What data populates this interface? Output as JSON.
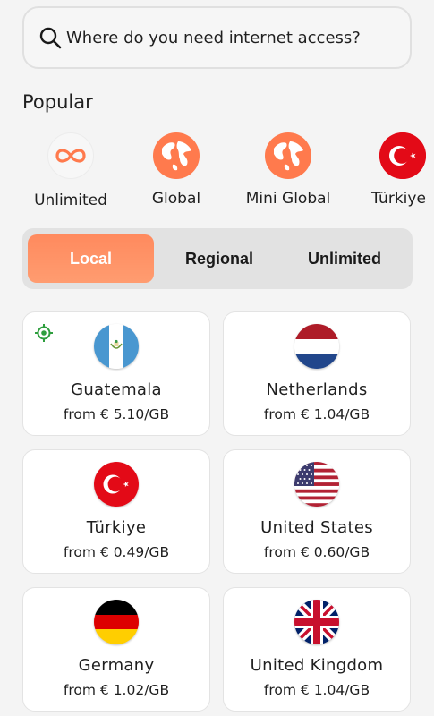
{
  "search": {
    "placeholder": "Where do you need internet access?"
  },
  "popular": {
    "title": "Popular",
    "items": [
      {
        "label": "Unlimited",
        "icon": "infinity-icon"
      },
      {
        "label": "Global",
        "icon": "globe-icon"
      },
      {
        "label": "Mini Global",
        "icon": "globe-icon"
      },
      {
        "label": "Türkiye",
        "icon": "turkey-flag-icon"
      }
    ]
  },
  "tabs": [
    {
      "label": "Local",
      "active": true
    },
    {
      "label": "Regional",
      "active": false
    },
    {
      "label": "Unlimited",
      "active": false
    }
  ],
  "countries": [
    {
      "name": "Guatemala",
      "price": "from € 5.10/GB",
      "flag": "guatemala-flag-icon",
      "current_location": true
    },
    {
      "name": "Netherlands",
      "price": "from € 1.04/GB",
      "flag": "netherlands-flag-icon"
    },
    {
      "name": "Türkiye",
      "price": "from € 0.49/GB",
      "flag": "turkey-flag-icon"
    },
    {
      "name": "United States",
      "price": "from € 0.60/GB",
      "flag": "usa-flag-icon"
    },
    {
      "name": "Germany",
      "price": "from € 1.02/GB",
      "flag": "germany-flag-icon"
    },
    {
      "name": "United Kingdom",
      "price": "from € 1.04/GB",
      "flag": "uk-flag-icon"
    }
  ],
  "colors": {
    "accent": "#ff8a5e",
    "location_green": "#2e9e3e",
    "turkey_red": "#e30a17"
  }
}
